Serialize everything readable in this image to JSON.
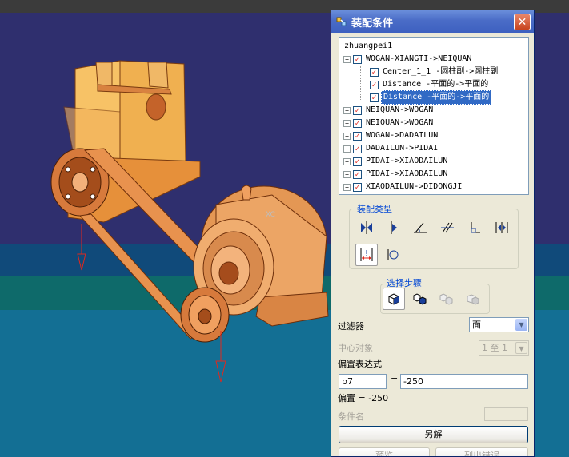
{
  "dialog": {
    "title": "装配条件",
    "close_glyph": "✕",
    "tree": {
      "root": "zhuangpei1",
      "items": [
        {
          "label": "WOGAN-XIANGTI->NEIQUAN",
          "expander": "−"
        },
        {
          "label": "Center_1_1 -圆柱副->圆柱副"
        },
        {
          "label": "Distance -平面的->平面的"
        },
        {
          "label": "Distance -平面的->平面的",
          "selected": true
        },
        {
          "label": "NEIQUAN->WOGAN",
          "expander": "+"
        },
        {
          "label": "NEIQUAN->WOGAN",
          "expander": "+"
        },
        {
          "label": "WOGAN->DADAILUN",
          "expander": "+"
        },
        {
          "label": "DADAILUN->PIDAI",
          "expander": "+"
        },
        {
          "label": "PIDAI->XIAODAILUN",
          "expander": "+"
        },
        {
          "label": "PIDAI->XIAODAILUN",
          "expander": "+"
        },
        {
          "label": "XIAODAILUN->DIDONGJI",
          "expander": "+"
        }
      ]
    },
    "assembly_type": {
      "title": "装配类型",
      "tools": [
        "mate-icon",
        "center-icon",
        "angle-icon",
        "parallel-icon",
        "perpendicular-icon",
        "align-icon",
        "distance-icon",
        "tangent-icon"
      ]
    },
    "select_step": {
      "title": "选择步骤",
      "tools": [
        "step1-icon",
        "step2-icon",
        "step3-icon",
        "step4-icon"
      ]
    },
    "filter": {
      "label": "过滤器",
      "value": "面"
    },
    "center_object": {
      "label": "中心对象",
      "value": "1 至 1"
    },
    "offset_expr": {
      "label": "偏置表达式",
      "name": "p7",
      "equals": "=",
      "value": "-250"
    },
    "offset_text": "偏置 = -250",
    "condition_name": {
      "label": "条件名",
      "value": ""
    },
    "buttons": {
      "solve": "另解",
      "preview": "预览",
      "list_errors": "列出错误"
    }
  },
  "colors": {
    "title_bar": "#3d60c0",
    "checkbox_mark": "#e0281e",
    "selection": "#316ac5",
    "group_title": "#0046d5",
    "model": "#f0a060",
    "viewport_top": "#2f2f6e",
    "viewport_bottom": "#136f94"
  }
}
